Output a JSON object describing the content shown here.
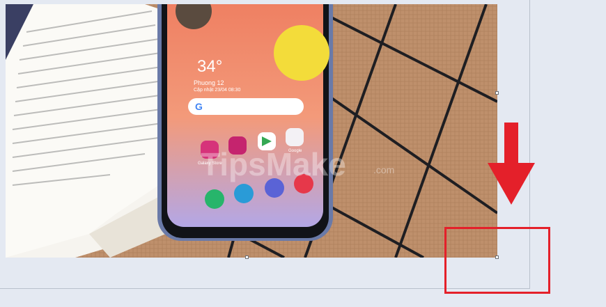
{
  "phone": {
    "temperature": "34°",
    "location": "Phuong 12",
    "date_line": "Cập nhật 23/04 08:30",
    "app_labels": [
      "Galaxy Store",
      "Google"
    ]
  },
  "watermark": {
    "text": "TipsMake",
    "suffix": ".com"
  },
  "colors": {
    "highlight_red": "#e4202a",
    "canvas_bg": "#e4e9f2"
  },
  "icons": {
    "arrow": "down-arrow-icon",
    "box": "highlight-rectangle"
  }
}
